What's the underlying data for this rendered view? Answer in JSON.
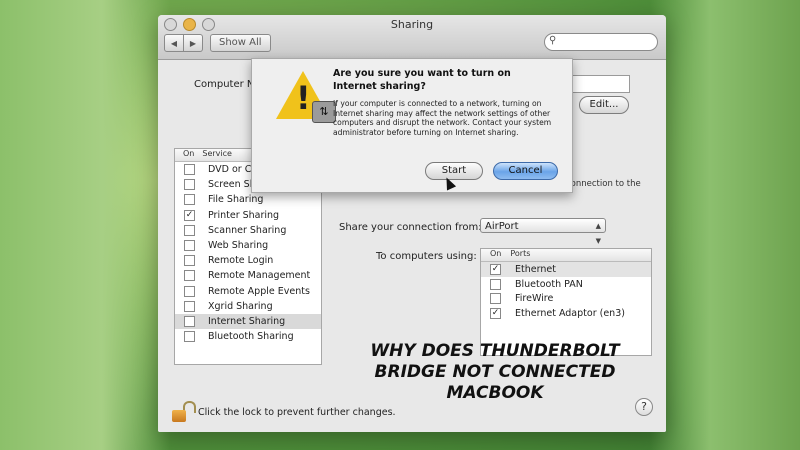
{
  "window": {
    "title": "Sharing",
    "show_all_label": "Show All",
    "search_placeholder": ""
  },
  "computer_name": {
    "label": "Computer Name:",
    "edit_label": "Edit..."
  },
  "services": {
    "col_on": "On",
    "col_service": "Service",
    "items": [
      {
        "label": "DVD or CD Sharing",
        "checked": false
      },
      {
        "label": "Screen Sharing",
        "checked": false
      },
      {
        "label": "File Sharing",
        "checked": false
      },
      {
        "label": "Printer Sharing",
        "checked": true
      },
      {
        "label": "Scanner Sharing",
        "checked": false
      },
      {
        "label": "Web Sharing",
        "checked": false
      },
      {
        "label": "Remote Login",
        "checked": false
      },
      {
        "label": "Remote Management",
        "checked": false
      },
      {
        "label": "Remote Apple Events",
        "checked": false
      },
      {
        "label": "Xgrid Sharing",
        "checked": false
      },
      {
        "label": "Internet Sharing",
        "checked": false,
        "selected": true
      },
      {
        "label": "Bluetooth Sharing",
        "checked": false
      }
    ]
  },
  "internet_sharing": {
    "note": "connection to the",
    "share_from_label": "Share your connection from:",
    "share_from_value": "AirPort",
    "to_computers_label": "To computers using:",
    "ports_col_on": "On",
    "ports_col_ports": "Ports",
    "ports": [
      {
        "label": "Ethernet",
        "checked": true,
        "selected": true
      },
      {
        "label": "Bluetooth PAN",
        "checked": false
      },
      {
        "label": "FireWire",
        "checked": false
      },
      {
        "label": "Ethernet Adaptor (en3)",
        "checked": true
      }
    ]
  },
  "lock": {
    "text": "Click the lock to prevent further changes."
  },
  "help_label": "?",
  "dialog": {
    "title": "Are you sure you want to turn on Internet sharing?",
    "body": "If your computer is connected to a network, turning on Internet sharing may affect the network settings of other computers and disrupt the network. Contact your system administrator before turning on Internet sharing.",
    "start_label": "Start",
    "cancel_label": "Cancel"
  },
  "overlay": {
    "line1": "WHY DOES THUNDERBOLT",
    "line2": "BRIDGE NOT CONNECTED",
    "line3": "MACBOOK"
  }
}
